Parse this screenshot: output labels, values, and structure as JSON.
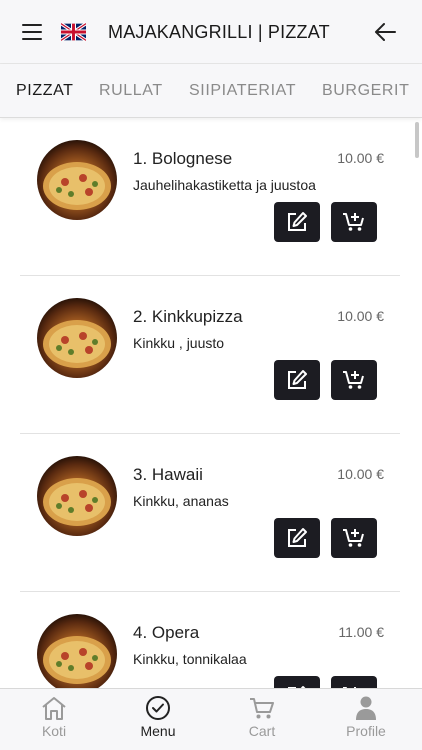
{
  "header": {
    "title": "MAJAKANGRILLI | PIZZAT"
  },
  "tabs": [
    {
      "label": "PIZZAT",
      "active": true
    },
    {
      "label": "RULLAT",
      "active": false
    },
    {
      "label": "SIIPIATERIAT",
      "active": false
    },
    {
      "label": "BURGERIT",
      "active": false
    }
  ],
  "items": [
    {
      "name": "1. Bolognese",
      "price": "10.00 €",
      "description": "Jauhelihakastiketta ja juustoa"
    },
    {
      "name": "2. Kinkkupizza",
      "price": "10.00 €",
      "description": "Kinkku , juusto"
    },
    {
      "name": "3. Hawaii",
      "price": "10.00 €",
      "description": "Kinkku, ananas"
    },
    {
      "name": "4. Opera",
      "price": "11.00 €",
      "description": "Kinkku, tonnikalaa"
    }
  ],
  "bottom_nav": [
    {
      "label": "Koti",
      "icon": "home-icon",
      "active": false
    },
    {
      "label": "Menu",
      "icon": "check-circle-icon",
      "active": true
    },
    {
      "label": "Cart",
      "icon": "cart-icon",
      "active": false
    },
    {
      "label": "Profile",
      "icon": "person-icon",
      "active": false
    }
  ],
  "colors": {
    "header_bg": "#f7f7f9",
    "button_bg": "#1c1c22",
    "active_text": "#1a1a1a",
    "inactive_text": "#8a8a8a"
  }
}
